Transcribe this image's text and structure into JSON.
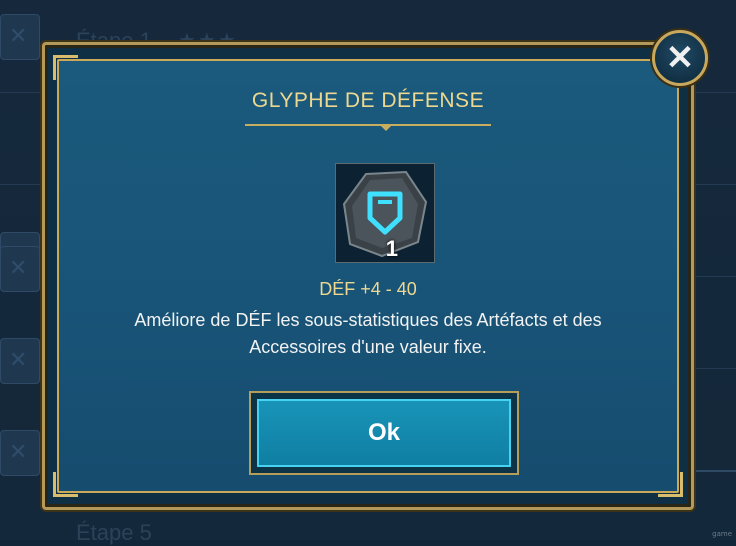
{
  "background": {
    "rows": [
      {
        "label": "Étape 1",
        "stars": "★★★"
      },
      {
        "label": "Étape 5",
        "stars": ""
      }
    ],
    "watermark": "game"
  },
  "dialog": {
    "title": "GLYPHE DE DÉFENSE",
    "glyph": {
      "icon": "defense-glyph-icon",
      "count": "1"
    },
    "stat_range": "DÉF +4 - 40",
    "description": "Améliore de DÉF les sous-statistiques des Artéfacts et des Accessoires d'une valeur fixe.",
    "ok_label": "Ok",
    "close_symbol": "✕"
  },
  "colors": {
    "gold": "#c9ad5f",
    "title_text": "#ecd88f",
    "panel_blue": "#185478",
    "button_cyan": "#1894b8"
  }
}
